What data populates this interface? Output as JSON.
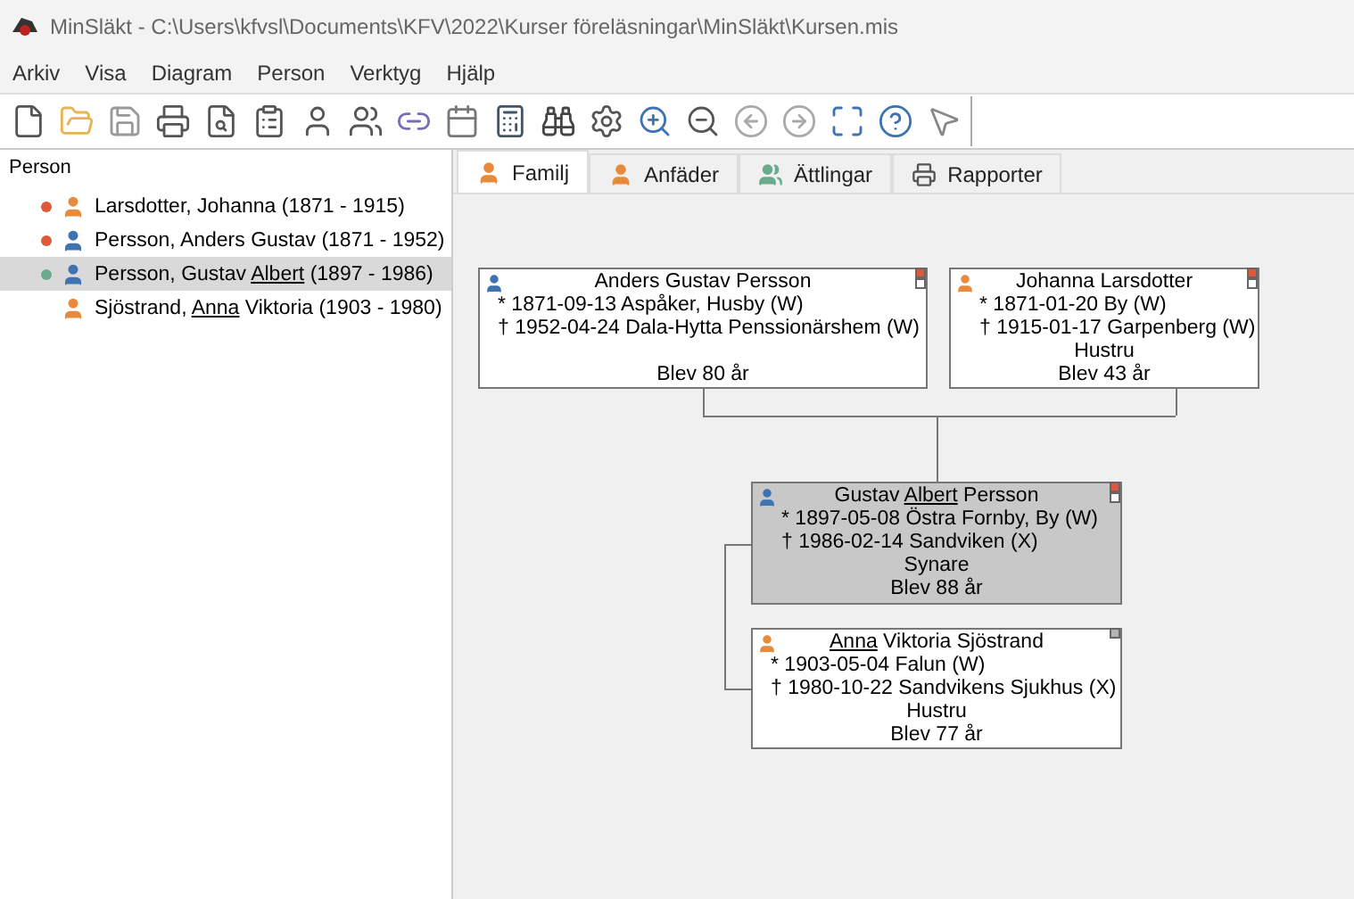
{
  "window": {
    "title": "MinSläkt - C:\\Users\\kfvsl\\Documents\\KFV\\2022\\Kurser föreläsningar\\MinSläkt\\Kursen.mis"
  },
  "menu": [
    "Arkiv",
    "Visa",
    "Diagram",
    "Person",
    "Verktyg",
    "Hjälp"
  ],
  "sidebar": {
    "title": "Person",
    "items": [
      {
        "kind": "female",
        "color": "#e0583a",
        "selected": false,
        "before": "Larsdotter, Johanna",
        "after": " (1871 - 1915)"
      },
      {
        "kind": "male",
        "color": "#e0583a",
        "selected": false,
        "before": "Persson, Anders Gustav",
        "after": " (1871 - 1952)"
      },
      {
        "kind": "male",
        "color": "#6aab8e",
        "selected": true,
        "before": "Persson, Gustav ",
        "call": "Albert",
        "after": " (1897 - 1986)"
      },
      {
        "kind": "female",
        "selected": false,
        "before": "Sjöstrand, ",
        "call": "Anna",
        "after": " Viktoria (1903 - 1980)"
      }
    ]
  },
  "tabs": [
    {
      "label": "Familj",
      "selected": true
    },
    {
      "label": "Anfäder",
      "selected": false
    },
    {
      "label": "Ättlingar",
      "selected": false
    },
    {
      "label": "Rapporter",
      "selected": false
    }
  ],
  "cards": [
    {
      "kind": "male",
      "selected": false,
      "color": "#e0583a",
      "after": "Anders Gustav Persson",
      "lines": [
        "* 1871-09-13 Aspåker, Husby (W)",
        "† 1952-04-24 Dala-Hytta Penssionärshem (W)"
      ],
      "age": "Blev 80 år"
    },
    {
      "kind": "female",
      "selected": false,
      "color": "#e0583a",
      "before": "Johanna Larsdotter",
      "lines": [
        "* 1871-01-20 By (W)",
        "† 1915-01-17 Garpenberg (W)"
      ],
      "relation": "Hustru",
      "age": "Blev 43 år"
    },
    {
      "kind": "male",
      "selected": true,
      "color": "#e0583a",
      "before": "Gustav ",
      "call": "Albert",
      "after": " Persson",
      "lines": [
        "* 1897-05-08 Östra Fornby, By (W)",
        "† 1986-02-14 Sandviken (X)"
      ],
      "relation": "Synare",
      "age": "Blev 88 år"
    },
    {
      "kind": "female",
      "selected": false,
      "color": "#b4b4b4",
      "call": "Anna",
      "after": " Viktoria Sjöstrand",
      "lines": [
        "* 1903-05-04 Falun (W)",
        "† 1980-10-22 Sandvikens Sjukhus (X)"
      ],
      "relation": "Hustru",
      "age": "Blev 77 år"
    }
  ]
}
